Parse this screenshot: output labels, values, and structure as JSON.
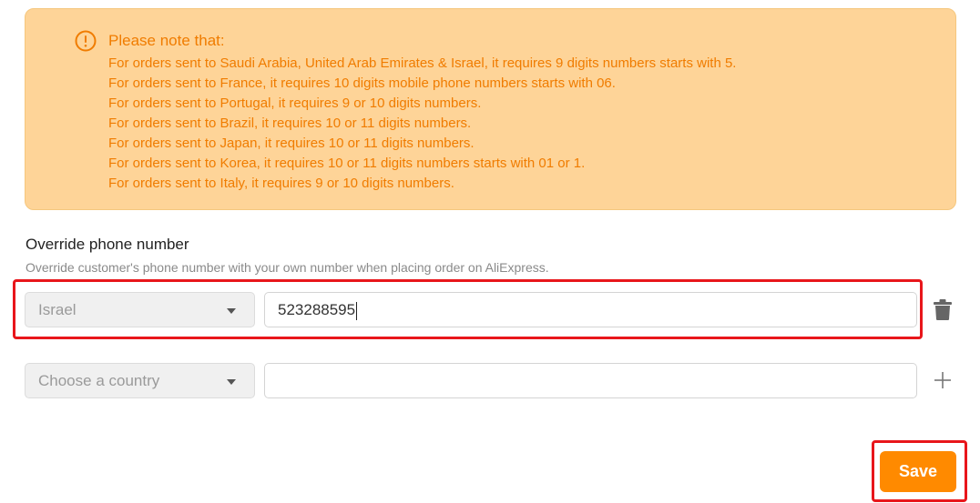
{
  "notice": {
    "title": "Please note that:",
    "lines": [
      "For orders sent to Saudi Arabia, United Arab Emirates & Israel, it requires 9 digits numbers starts with 5.",
      "For orders sent to France, it requires 10 digits mobile phone numbers starts with 06.",
      "For orders sent to Portugal, it requires 9 or 10 digits numbers.",
      "For orders sent to Brazil, it requires 10 or 11 digits numbers.",
      "For orders sent to Japan, it requires 10 or 11 digits numbers.",
      "For orders sent to Korea, it requires 10 or 11 digits numbers starts with 01 or 1.",
      "For orders sent to Italy, it requires 9 or 10 digits numbers."
    ],
    "icon": "exclamation-circle-icon",
    "color": "#f07c00",
    "background": "#fed498"
  },
  "override": {
    "title": "Override phone number",
    "description": "Override customer's phone number with your own number when placing order on AliExpress.",
    "rows": [
      {
        "country": "Israel",
        "phone": "523288595",
        "action_icon": "trash-icon"
      },
      {
        "country_placeholder": "Choose a country",
        "phone": "",
        "action_icon": "plus-icon"
      }
    ]
  },
  "save_label": "Save",
  "colors": {
    "accent": "#ff8a00",
    "highlight": "#e8161b"
  }
}
